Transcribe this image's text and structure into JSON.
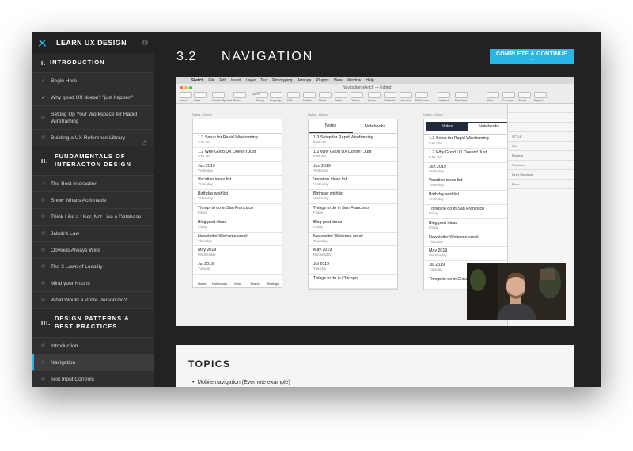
{
  "sidebar": {
    "brand": "LEARN UX DESIGN",
    "sections": [
      {
        "num": "I.",
        "title": "INTRODUCTION",
        "items": [
          {
            "label": "Begin Here",
            "state": "done"
          },
          {
            "label": "Why good UX doesn't \"just happen\"",
            "state": "done"
          },
          {
            "label": "Setting Up Your Workspace for Rapid Wireframing",
            "state": "todo"
          },
          {
            "label": "Building a UX Reference Library",
            "state": "todo"
          }
        ]
      },
      {
        "num": "II.",
        "title": "FUNDAMENTALS OF INTERACTON DESIGN",
        "items": [
          {
            "label": "The Best Interaction",
            "state": "done"
          },
          {
            "label": "Show What's Actionable",
            "state": "todo"
          },
          {
            "label": "Think Like a User, Not Like a Database",
            "state": "todo"
          },
          {
            "label": "Jakob's Law",
            "state": "todo"
          },
          {
            "label": "Obvious Always Wins",
            "state": "todo"
          },
          {
            "label": "The 3 Laws of Locality",
            "state": "todo"
          },
          {
            "label": "Mind your Nouns",
            "state": "todo"
          },
          {
            "label": "What Would a Polite Person Do?",
            "state": "todo"
          }
        ]
      },
      {
        "num": "III.",
        "title": "DESIGN PATTERNS & BEST PRACTICES",
        "items": [
          {
            "label": "Introduction",
            "state": "todo"
          },
          {
            "label": "Navigation",
            "state": "active"
          },
          {
            "label": "Text Input Controls",
            "state": "todo"
          }
        ]
      }
    ]
  },
  "lesson": {
    "number": "3.2",
    "title": "NAVIGATION",
    "cta": "COMPLETE & CONTINUE →"
  },
  "screenshot": {
    "menu": [
      "Sketch",
      "File",
      "Edit",
      "Insert",
      "Layer",
      "Text",
      "Prototyping",
      "Arrange",
      "Plugins",
      "View",
      "Window",
      "Help"
    ],
    "doc_title": "Navigation.sketch — Edited",
    "toolbar_labels": [
      "Insert",
      "Data",
      "Create Symbol",
      "Zoom",
      "Group",
      "Ungroup",
      "Edit",
      "Rotate",
      "Mask",
      "Scale",
      "Flatten",
      "Union",
      "Subtract",
      "Intersect",
      "Difference",
      "Forward",
      "Backward",
      "View",
      "Preview",
      "Cloud",
      "Export"
    ],
    "zoom": "100%",
    "inspector": [
      "STYLE",
      "Fills",
      "Borders",
      "Shadows",
      "Inner Shadows",
      "Blurs"
    ],
    "phones": [
      {
        "caption": "Notes - Home",
        "tabs": [],
        "has_nav": true
      },
      {
        "caption": "Notes - Home",
        "tabs": [
          "Notes",
          "Notebooks"
        ],
        "has_nav": false
      },
      {
        "caption": "Notes - Home",
        "tabs": [
          "Notes",
          "Notebooks"
        ],
        "has_nav": false,
        "dark_tab": true
      }
    ],
    "notes": [
      {
        "title": "1.3 Setup for Rapid Wireframing",
        "sub": "9:12 AM"
      },
      {
        "title": "1.2 Why Good UX Doesn't Just",
        "sub": "8:56 AM"
      },
      {
        "title": "Jun 2019",
        "sub": "Yesterday"
      },
      {
        "title": "Vacation ideas list",
        "sub": "Yesterday"
      },
      {
        "title": "Birthday wishlist",
        "sub": "Yesterday"
      },
      {
        "title": "Things to do in San Francisco",
        "sub": "Friday"
      },
      {
        "title": "Blog post ideas",
        "sub": "Friday"
      },
      {
        "title": "Newsletter Welcome email",
        "sub": "Thursday"
      },
      {
        "title": "May 2019",
        "sub": "Wednesday"
      },
      {
        "title": "Jul 2019",
        "sub": "Tuesday"
      },
      {
        "title": "Things to do in Chicago",
        "sub": ""
      }
    ],
    "nav": [
      "Notes",
      "Notebooks",
      "New",
      "Search",
      "Settings"
    ]
  },
  "topics": {
    "heading": "TOPICS",
    "items": [
      "Mobile navigation (Evernote example)"
    ]
  }
}
